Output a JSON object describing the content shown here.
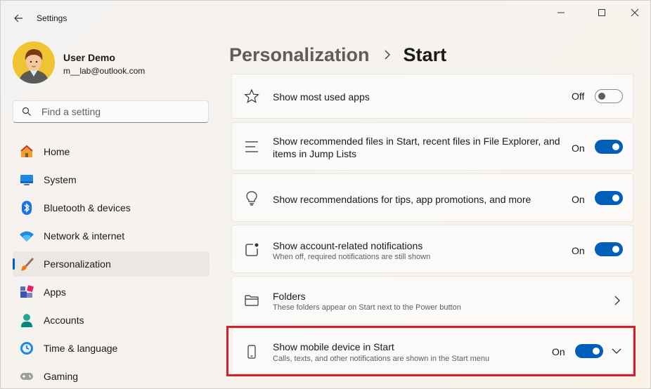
{
  "app": {
    "title": "Settings"
  },
  "user": {
    "name": "User Demo",
    "email": "m__lab@outlook.com"
  },
  "search": {
    "placeholder": "Find a setting"
  },
  "nav": [
    {
      "label": "Home",
      "icon": "home-icon"
    },
    {
      "label": "System",
      "icon": "system-icon"
    },
    {
      "label": "Bluetooth & devices",
      "icon": "bluetooth-icon"
    },
    {
      "label": "Network & internet",
      "icon": "wifi-icon"
    },
    {
      "label": "Personalization",
      "icon": "brush-icon",
      "selected": true
    },
    {
      "label": "Apps",
      "icon": "apps-icon"
    },
    {
      "label": "Accounts",
      "icon": "account-icon"
    },
    {
      "label": "Time & language",
      "icon": "clock-globe-icon"
    },
    {
      "label": "Gaming",
      "icon": "gamepad-icon"
    }
  ],
  "header": {
    "parent": "Personalization",
    "current": "Start"
  },
  "settings": [
    {
      "title": "Show most used apps",
      "state": "Off",
      "on": false,
      "icon": "star-icon"
    },
    {
      "title": "Show recommended files in Start, recent files in File Explorer, and items in Jump Lists",
      "state": "On",
      "on": true,
      "icon": "list-icon"
    },
    {
      "title": "Show recommendations for tips, app promotions, and more",
      "state": "On",
      "on": true,
      "icon": "lightbulb-icon"
    },
    {
      "title": "Show account-related notifications",
      "subtitle": "When off, required notifications are still shown",
      "state": "On",
      "on": true,
      "icon": "notification-icon"
    },
    {
      "title": "Folders",
      "subtitle": "These folders appear on Start next to the Power button",
      "icon": "folder-icon"
    },
    {
      "title": "Show mobile device in Start",
      "subtitle": "Calls, texts, and other notifications are shown in the Start menu",
      "state": "On",
      "on": true,
      "icon": "phone-icon"
    }
  ],
  "colors": {
    "accent": "#005fb8",
    "highlight": "#d1202a"
  }
}
